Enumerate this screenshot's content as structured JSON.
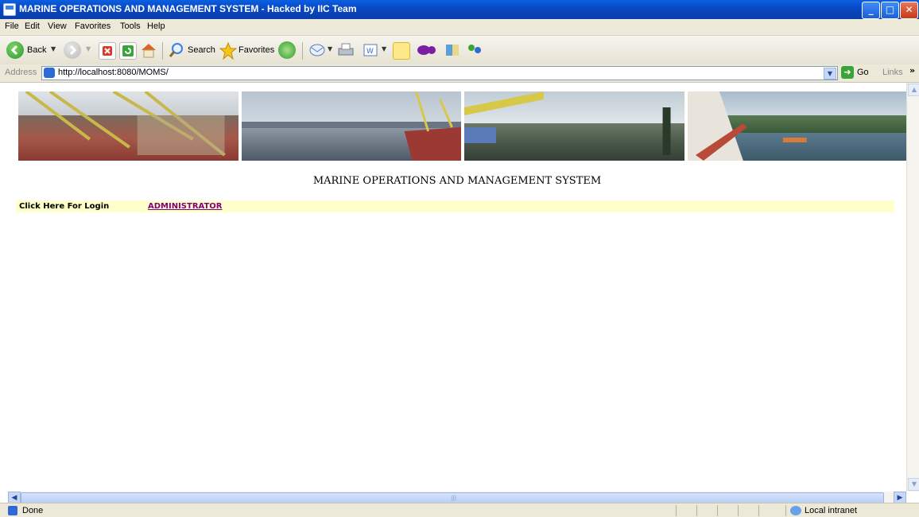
{
  "window": {
    "title": "MARINE OPERATIONS AND MANAGEMENT SYSTEM - Hacked by IIC Team",
    "controls": {
      "minimize": "_",
      "maximize": "□",
      "close": "✕"
    }
  },
  "menu": [
    "File",
    "Edit",
    "View",
    "Favorites",
    "Tools",
    "Help"
  ],
  "toolbar": {
    "back_label": "Back",
    "search_label": "Search",
    "favorites_label": "Favorites"
  },
  "address": {
    "label": "Address",
    "url": "http://localhost:8080/MOMS/",
    "go_label": "Go",
    "links_label": "Links",
    "links_chevron": "»"
  },
  "page": {
    "heading": "MARINE OPERATIONS AND MANAGEMENT SYSTEM",
    "login_prompt": "Click Here For Login",
    "admin_link": "ADMINISTRATOR"
  },
  "status": {
    "text": "Done",
    "zone": "Local intranet"
  },
  "icons": {
    "back": "back-arrow-icon",
    "forward": "forward-arrow-icon",
    "stop": "stop-icon",
    "refresh": "refresh-icon",
    "home": "home-icon",
    "search": "search-icon",
    "favorites": "favorites-star-icon",
    "history": "history-icon",
    "mail": "mail-icon",
    "print": "print-icon",
    "edit": "word-edit-icon",
    "notes": "notes-icon",
    "yahoo": "yahoo-icon",
    "research": "research-icon",
    "messenger": "messenger-icon"
  }
}
